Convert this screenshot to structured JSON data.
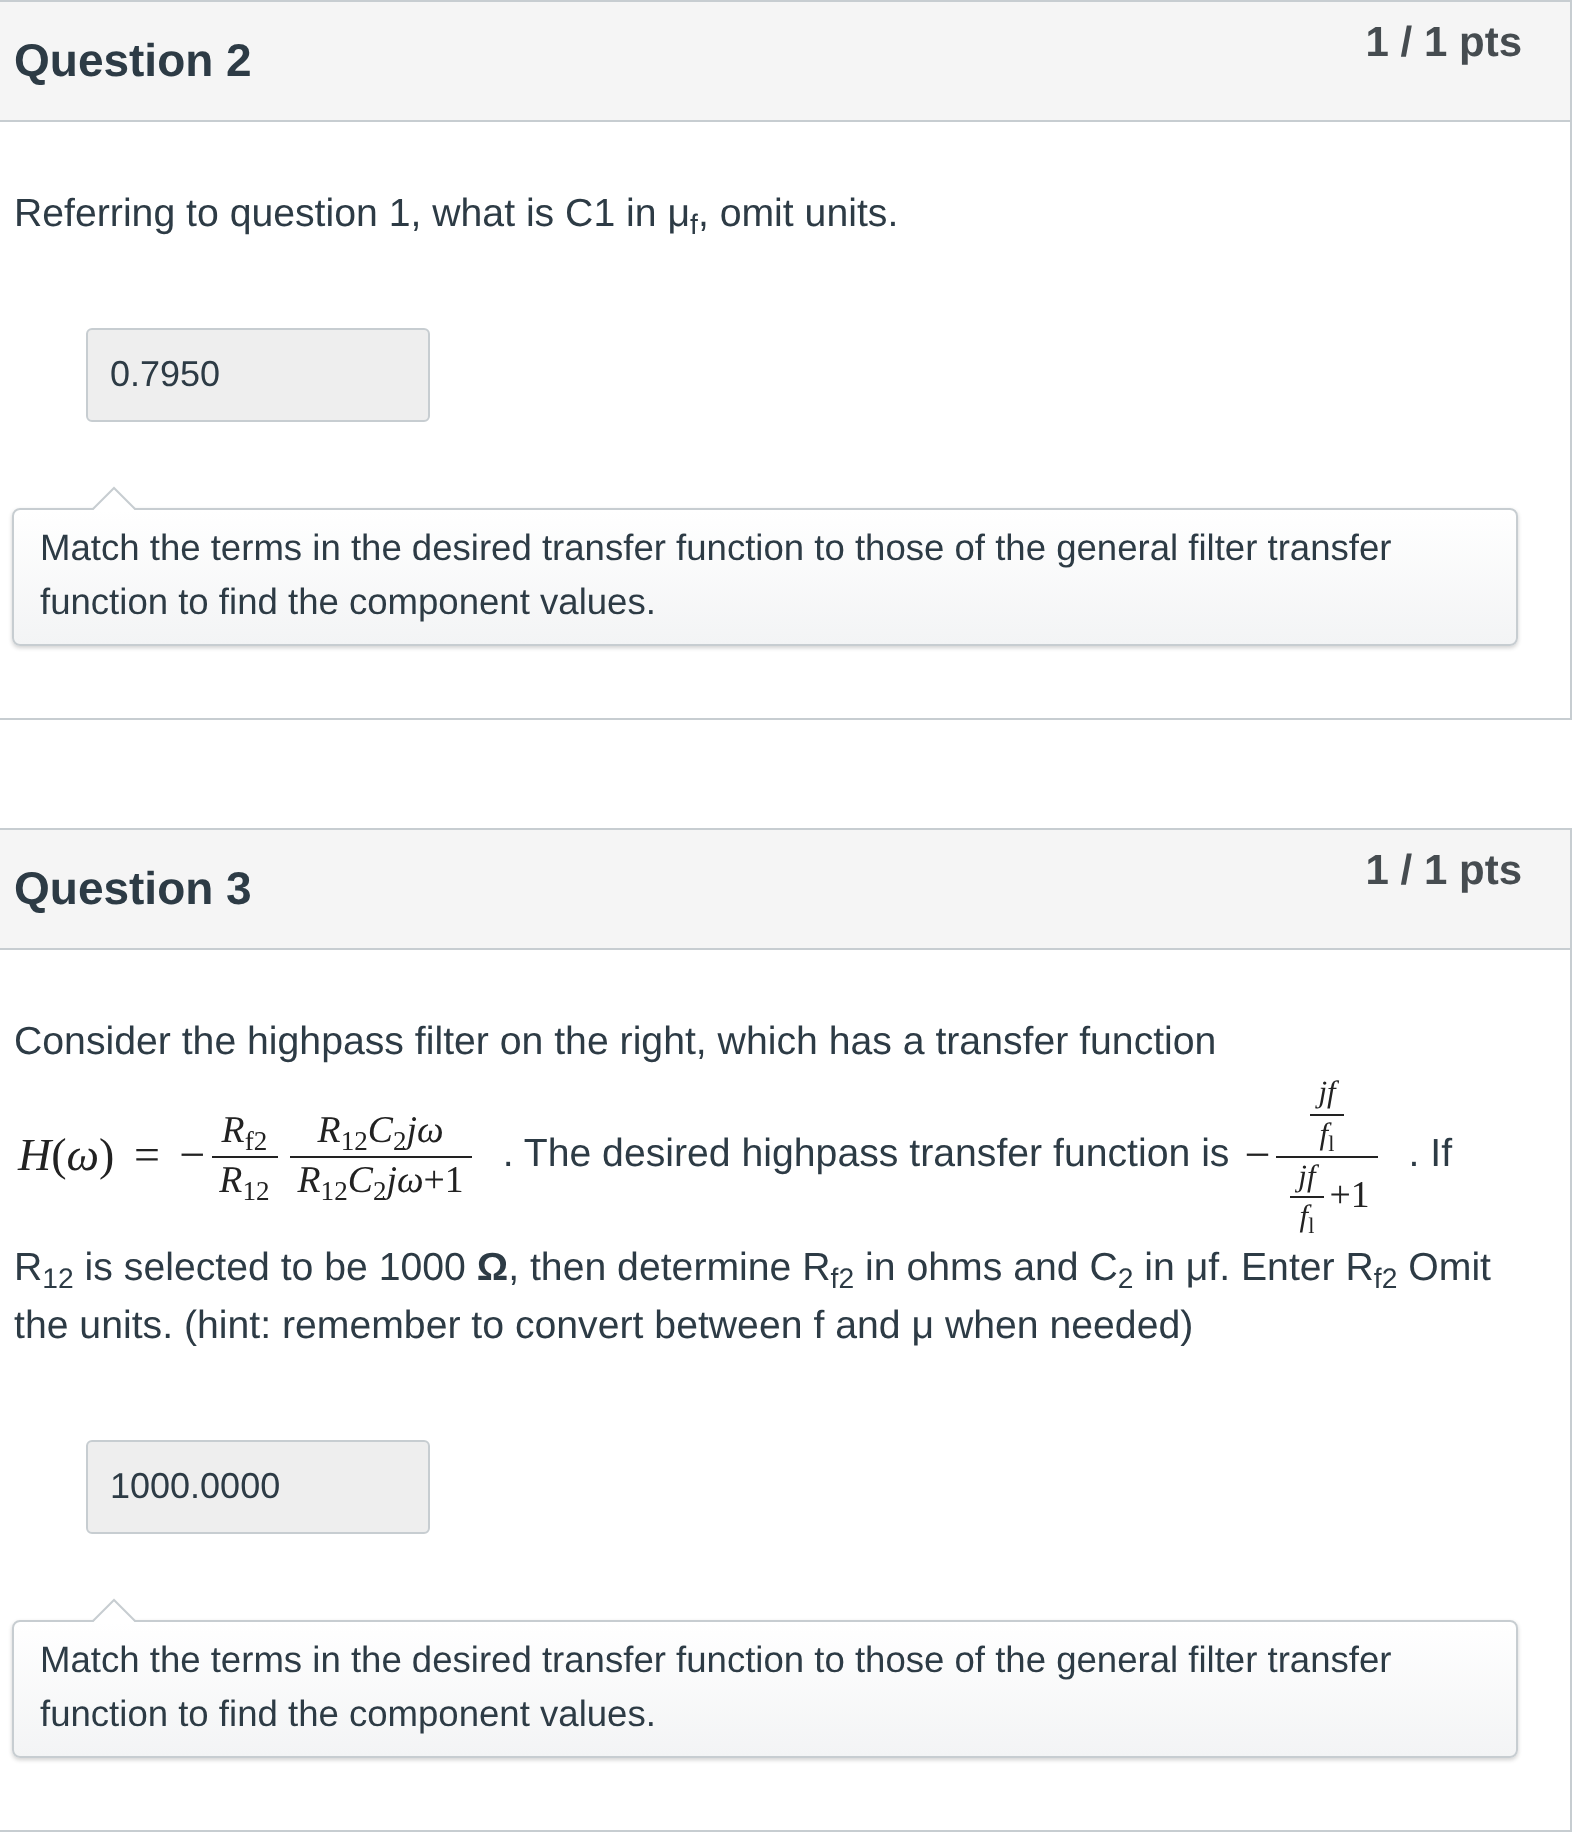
{
  "questions": [
    {
      "title": "Question 2",
      "points": "1 / 1 pts",
      "prompt": [
        {
          "kind": "text",
          "text": "Referring to question 1, what is C1 in μ$_{f}$, omit units."
        }
      ],
      "answer": "0.7950",
      "comment": "Match the terms in the desired transfer function to those of the general filter transfer function to find the component values."
    },
    {
      "title": "Question 3",
      "points": "1 / 1 pts",
      "prompt": [
        {
          "kind": "text",
          "text": "Consider the highpass filter on the right, which has a transfer function"
        },
        {
          "kind": "math",
          "items": [
            {
              "kind": "text",
              "text": "*H*(*ω*) = −"
            },
            {
              "kind": "fraction",
              "numerator": [
                {
                  "kind": "text",
                  "text": "*R*$_{f2}$"
                }
              ],
              "denominator": [
                {
                  "kind": "text",
                  "text": "*R*$_{12}$"
                }
              ]
            },
            {
              "kind": "fraction",
              "numerator": [
                {
                  "kind": "text",
                  "text": "*R*$_{12}$*C*$_{2}$*jω*"
                }
              ],
              "denominator": [
                {
                  "kind": "text",
                  "text": "*R*$_{12}$*C*$_{2}$*jω*+1"
                }
              ]
            }
          ]
        },
        {
          "kind": "text",
          "text": ". The desired highpass transfer function is"
        },
        {
          "kind": "math",
          "items": [
            {
              "kind": "text",
              "text": "−"
            },
            {
              "kind": "fraction",
              "numerator": [
                {
                  "kind": "fraction",
                  "numerator": [
                    {
                      "kind": "text",
                      "text": "*jf*"
                    }
                  ],
                  "denominator": [
                    {
                      "kind": "text",
                      "text": "*f*$_{l}$"
                    }
                  ]
                }
              ],
              "denominator": [
                {
                  "kind": "fraction",
                  "numerator": [
                    {
                      "kind": "text",
                      "text": "*jf*"
                    }
                  ],
                  "denominator": [
                    {
                      "kind": "text",
                      "text": "*f*$_{l}$"
                    }
                  ]
                },
                {
                  "kind": "text",
                  "text": "+1"
                }
              ]
            }
          ]
        },
        {
          "kind": "text",
          "text": ". If R$_{12}$ is selected to be 1000 **Ω**, then determine R$_{f2}$ in ohms and C$_{2}$ in μf. Enter R$_{f2}$ Omit the units. (hint: remember to convert between f and μ when needed)"
        }
      ],
      "answer": "1000.0000",
      "comment": "Match the terms in the desired transfer function to those of the general filter transfer function to find the component values."
    }
  ]
}
